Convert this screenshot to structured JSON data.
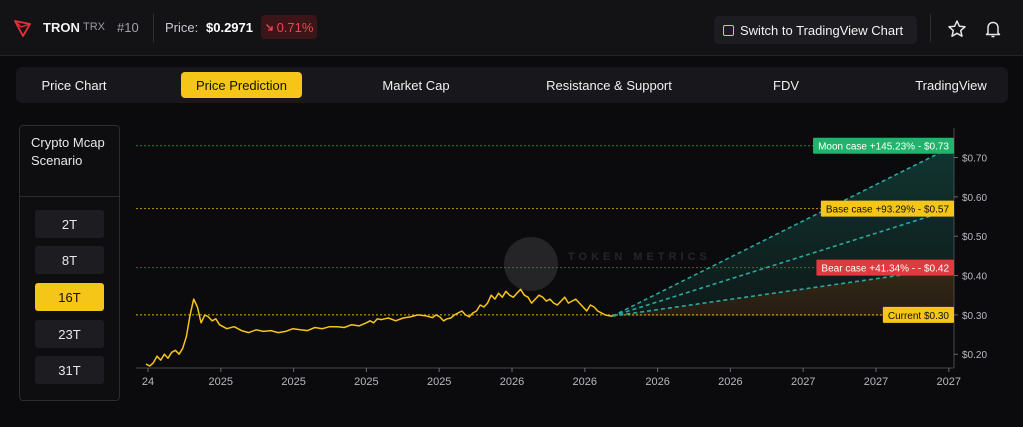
{
  "header": {
    "coin_name": "TRON",
    "coin_symbol": "TRX",
    "rank": "#10",
    "price_label": "Price:",
    "price": "$0.2971",
    "change": "0.71%",
    "change_icon": "arrow-down-right-icon",
    "change_color": "#f0464d",
    "tv_button_label": "Switch to TradingView Chart",
    "star_icon": "star-icon",
    "bell_icon": "bell-icon"
  },
  "tabs": [
    {
      "label": "Price Chart",
      "active": false
    },
    {
      "label": "Price Prediction",
      "active": true
    },
    {
      "label": "Market Cap",
      "active": false
    },
    {
      "label": "Resistance & Support",
      "active": false
    },
    {
      "label": "FDV",
      "active": false
    },
    {
      "label": "TradingView",
      "active": false
    }
  ],
  "sidebar": {
    "title": "Crypto Mcap Scenario",
    "options": [
      {
        "label": "2T",
        "active": false
      },
      {
        "label": "8T",
        "active": false
      },
      {
        "label": "16T",
        "active": true
      },
      {
        "label": "23T",
        "active": false
      },
      {
        "label": "31T",
        "active": false
      }
    ]
  },
  "colors": {
    "accent": "#f5c518",
    "moon": "#1fb46b",
    "base": "#f5c518",
    "bear": "#e0393f",
    "current": "#f5c518",
    "projection_line": "#2aa8a0"
  },
  "chart_data": {
    "type": "line",
    "watermark": "TOKEN METRICS",
    "x_tick_labels": [
      "24",
      "2025",
      "2025",
      "2025",
      "2025",
      "2026",
      "2026",
      "2026",
      "2026",
      "2027",
      "2027",
      "2027"
    ],
    "y_ticks": [
      0.2,
      0.3,
      0.4,
      0.5,
      0.6,
      0.7
    ],
    "y_tick_labels": [
      "$0.20",
      "$0.30",
      "$0.40",
      "$0.50",
      "$0.60",
      "$0.70"
    ],
    "ylim": [
      0.165,
      0.775
    ],
    "xlim": [
      0,
      11
    ],
    "grid": false,
    "price_series": {
      "x": [
        0,
        0.05,
        0.1,
        0.15,
        0.2,
        0.25,
        0.3,
        0.35,
        0.4,
        0.45,
        0.5,
        0.55,
        0.6,
        0.65,
        0.7,
        0.75,
        0.8,
        0.85,
        0.9,
        0.95,
        1.0,
        1.1,
        1.2,
        1.3,
        1.4,
        1.5,
        1.6,
        1.7,
        1.8,
        1.9,
        2.0,
        2.1,
        2.2,
        2.3,
        2.4,
        2.5,
        2.6,
        2.7,
        2.8,
        2.9,
        3.0,
        3.05,
        3.1,
        3.15,
        3.2,
        3.25,
        3.3,
        3.4,
        3.5,
        3.6,
        3.7,
        3.8,
        3.9,
        3.95,
        4.0,
        4.05,
        4.1,
        4.15,
        4.2,
        4.25,
        4.3,
        4.35,
        4.4,
        4.45,
        4.5,
        4.55,
        4.6,
        4.65,
        4.7,
        4.75,
        4.8,
        4.85,
        4.9,
        4.95,
        5.0,
        5.05,
        5.1,
        5.15,
        5.2,
        5.25,
        5.3,
        5.35,
        5.4,
        5.45,
        5.5,
        5.55,
        5.6,
        5.65,
        5.7,
        5.75,
        5.8,
        5.85,
        5.9,
        5.95,
        6.0,
        6.05,
        6.1,
        6.15,
        6.2,
        6.25,
        6.3,
        6.35
      ],
      "y": [
        0.175,
        0.17,
        0.178,
        0.195,
        0.185,
        0.2,
        0.19,
        0.205,
        0.21,
        0.2,
        0.215,
        0.245,
        0.3,
        0.34,
        0.32,
        0.28,
        0.3,
        0.295,
        0.285,
        0.29,
        0.275,
        0.265,
        0.27,
        0.26,
        0.255,
        0.262,
        0.258,
        0.26,
        0.255,
        0.258,
        0.265,
        0.262,
        0.26,
        0.268,
        0.265,
        0.27,
        0.27,
        0.268,
        0.275,
        0.272,
        0.28,
        0.285,
        0.28,
        0.29,
        0.288,
        0.29,
        0.292,
        0.285,
        0.292,
        0.295,
        0.3,
        0.298,
        0.293,
        0.3,
        0.295,
        0.285,
        0.29,
        0.292,
        0.3,
        0.305,
        0.31,
        0.3,
        0.295,
        0.305,
        0.31,
        0.325,
        0.32,
        0.33,
        0.35,
        0.34,
        0.355,
        0.345,
        0.36,
        0.35,
        0.345,
        0.355,
        0.365,
        0.35,
        0.345,
        0.33,
        0.34,
        0.35,
        0.345,
        0.335,
        0.34,
        0.33,
        0.325,
        0.335,
        0.345,
        0.33,
        0.335,
        0.34,
        0.33,
        0.32,
        0.31,
        0.325,
        0.32,
        0.31,
        0.305,
        0.3,
        0.298,
        0.297
      ]
    },
    "scenarios": [
      {
        "label": "Moon case +145.23% - $0.73",
        "value": 0.73,
        "kind": "moon"
      },
      {
        "label": "Base case +93.29% - $0.57",
        "value": 0.57,
        "kind": "base"
      },
      {
        "label": "Bear case +41.34% - - $0.42",
        "value": 0.42,
        "kind": "bear"
      },
      {
        "label": "Current $0.30",
        "value": 0.3,
        "kind": "current"
      }
    ],
    "projection": {
      "x_start": 6.35,
      "y_start": 0.297,
      "x_end": 11,
      "targets": [
        0.73,
        0.57,
        0.42
      ]
    }
  }
}
